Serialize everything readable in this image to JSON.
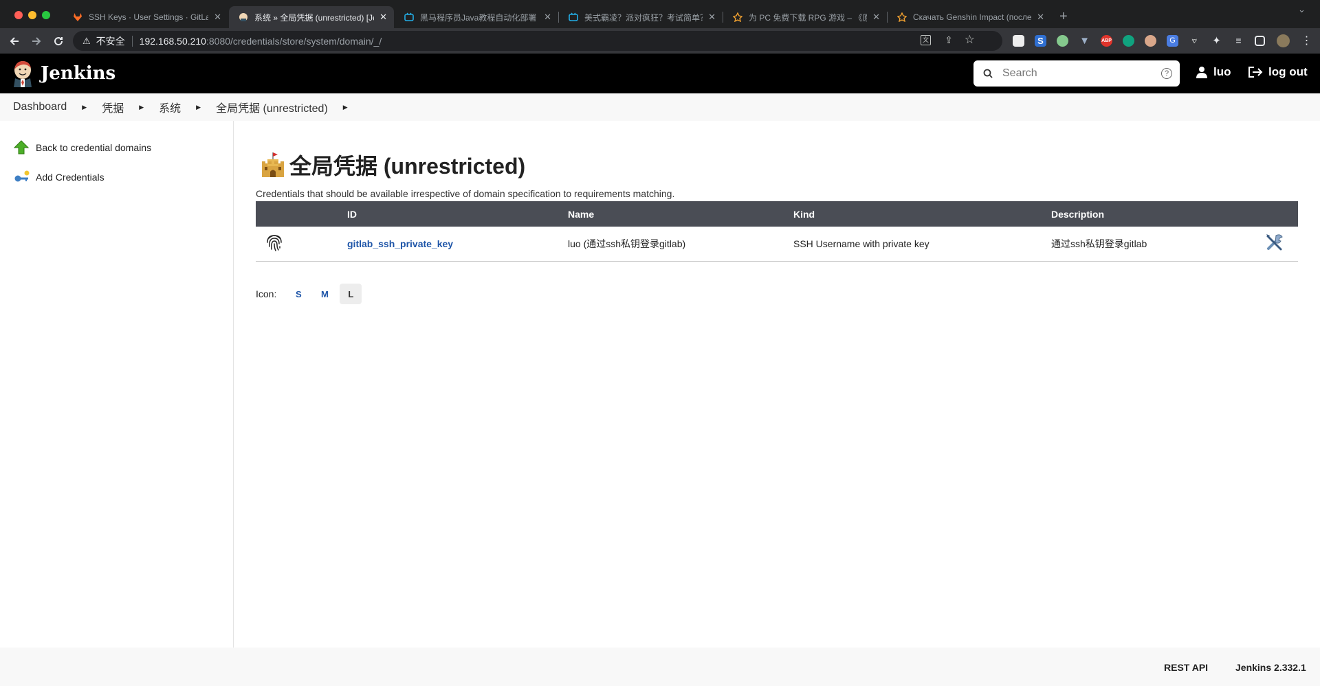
{
  "browser": {
    "tabs": [
      {
        "title": "SSH Keys · User Settings · GitLab",
        "active": false
      },
      {
        "title": "系统 » 全局凭据 (unrestricted) [Jenkins]",
        "active": true
      },
      {
        "title": "黑马程序员Java教程自动化部署",
        "active": false
      },
      {
        "title": "美式霸凌？派对疯狂？考试简单？",
        "active": false
      },
      {
        "title": "为 PC 免费下载 RPG 游戏 – 《原神》",
        "active": false
      },
      {
        "title": "Скачать Genshin Impact (последняя версия)",
        "active": false
      }
    ],
    "security_label": "不安全",
    "url_host": "192.168.50.210",
    "url_path": ":8080/credentials/store/system/domain/_/",
    "extension_icons": [
      "translate-icon",
      "share-icon",
      "bookmark-star-icon",
      "ext-reader-icon",
      "ext-s-icon",
      "ext-circle-icon",
      "ext-v-icon",
      "adblock-icon",
      "ext-chatgpt-icon",
      "ext-face-icon",
      "google-translate-icon",
      "ext-cast-icon",
      "puzzle-icon",
      "media-icon",
      "sidebar-icon",
      "profile-avatar-icon",
      "menu-icon"
    ],
    "adblock_text": "ABP"
  },
  "header": {
    "logo_text": "Jenkins",
    "search_placeholder": "Search",
    "user_name": "luo",
    "logout_label": "log out"
  },
  "breadcrumbs": [
    "Dashboard",
    "凭据",
    "系统",
    "全局凭据 (unrestricted)"
  ],
  "side_panel": {
    "tasks": [
      {
        "label": "Back to credential domains",
        "icon": "up-arrow-icon"
      },
      {
        "label": "Add Credentials",
        "icon": "add-key-icon"
      }
    ]
  },
  "main": {
    "title": "全局凭据 (unrestricted)",
    "description": "Credentials that should be available irrespective of domain specification to requirements matching.",
    "table": {
      "headers": [
        "",
        "ID",
        "Name",
        "Kind",
        "Description",
        ""
      ],
      "rows": [
        {
          "id": "gitlab_ssh_private_key",
          "name": "luo (通过ssh私钥登录gitlab)",
          "kind": "SSH Username with private key",
          "description": "通过ssh私钥登录gitlab"
        }
      ]
    },
    "icon_size": {
      "label": "Icon:",
      "options": [
        "S",
        "M",
        "L"
      ],
      "selected": "L"
    }
  },
  "footer": {
    "rest_api": "REST API",
    "version": "Jenkins 2.332.1"
  },
  "colors": {
    "header_bg": "#000000",
    "table_header_bg": "#4a4d55",
    "link": "#1e55a8"
  }
}
